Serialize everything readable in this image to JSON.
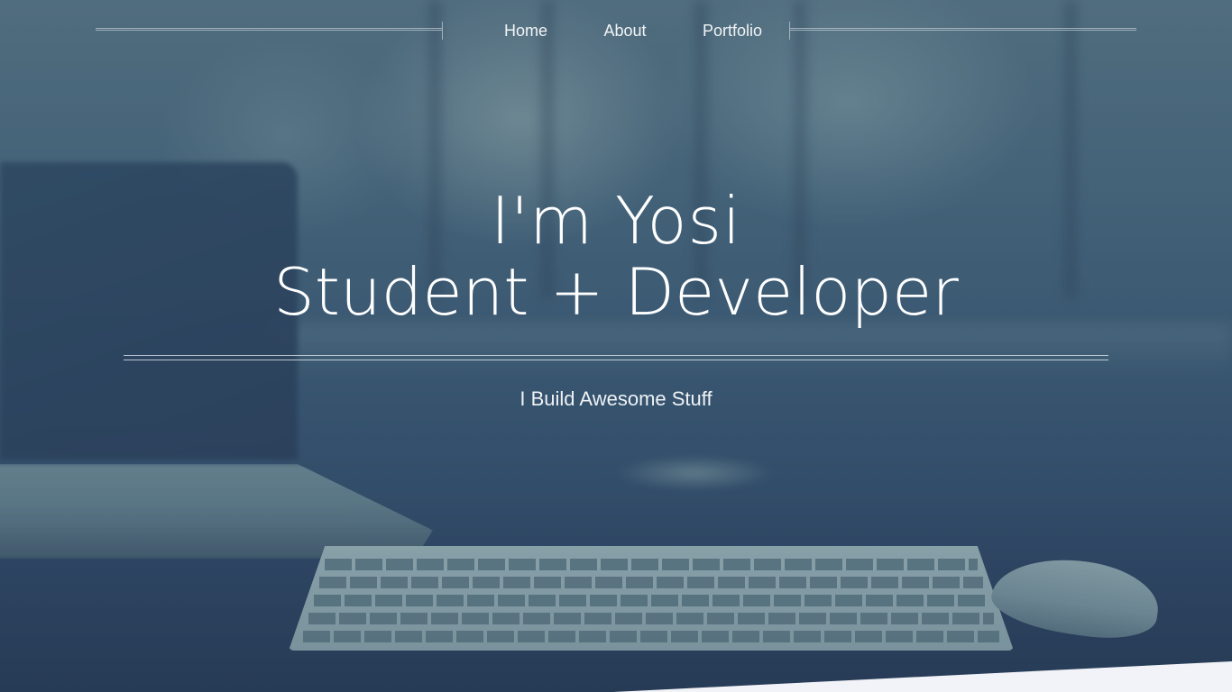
{
  "nav": {
    "items": [
      {
        "label": "Home"
      },
      {
        "label": "About"
      },
      {
        "label": "Portfolio"
      }
    ]
  },
  "hero": {
    "title_line1": "I'm Yosi",
    "title_line2": "Student + Developer",
    "tagline": "I Build Awesome Stuff"
  },
  "colors": {
    "overlay": "#2c4264",
    "text": "#ffffff",
    "bottom_wedge": "#f2f3f8"
  }
}
